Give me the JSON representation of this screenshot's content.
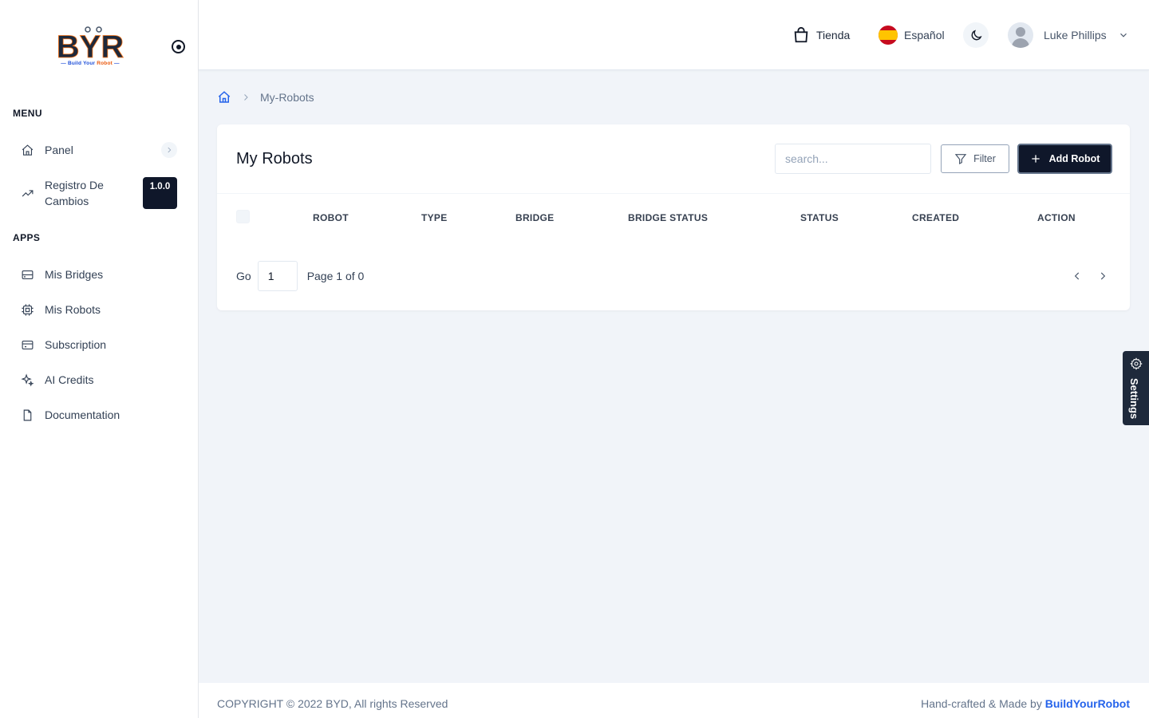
{
  "logo": {
    "mark": "BYR",
    "tagline_a": "Build Your ",
    "tagline_b": "Robot"
  },
  "sidebar": {
    "menu_title": "MENU",
    "apps_title": "APPS",
    "menu_items": [
      {
        "label": "Panel",
        "icon": "home-icon"
      },
      {
        "label": "Registro De Cambios",
        "icon": "trending-up-icon",
        "badge": "1.0.0"
      }
    ],
    "app_items": [
      {
        "label": "Mis Bridges",
        "icon": "hard-drive-icon"
      },
      {
        "label": "Mis Robots",
        "icon": "cpu-icon"
      },
      {
        "label": "Subscription",
        "icon": "credit-card-icon"
      },
      {
        "label": "AI Credits",
        "icon": "sparkles-icon"
      },
      {
        "label": "Documentation",
        "icon": "file-icon"
      }
    ]
  },
  "header": {
    "shop_label": "Tienda",
    "language_label": "Español",
    "user_name": "Luke Phillips"
  },
  "breadcrumb": {
    "current": "My-Robots"
  },
  "card": {
    "title": "My Robots",
    "search_placeholder": "search...",
    "filter_label": "Filter",
    "add_label": "Add Robot",
    "columns": [
      "ROBOT",
      "TYPE",
      "BRIDGE",
      "BRIDGE STATUS",
      "STATUS",
      "CREATED",
      "ACTION"
    ],
    "pager": {
      "go_label": "Go",
      "page_value": "1",
      "page_text": "Page 1 of 0"
    }
  },
  "settings_label": "Settings",
  "footer": {
    "copyright": "COPYRIGHT © 2022 BYD, All rights Reserved",
    "made_by_prefix": "Hand-crafted & Made by ",
    "brand": "BuildYourRobot"
  },
  "colors": {
    "primary_dark": "#0f172a",
    "brand_blue": "#2563eb",
    "background": "#f1f4f9"
  }
}
